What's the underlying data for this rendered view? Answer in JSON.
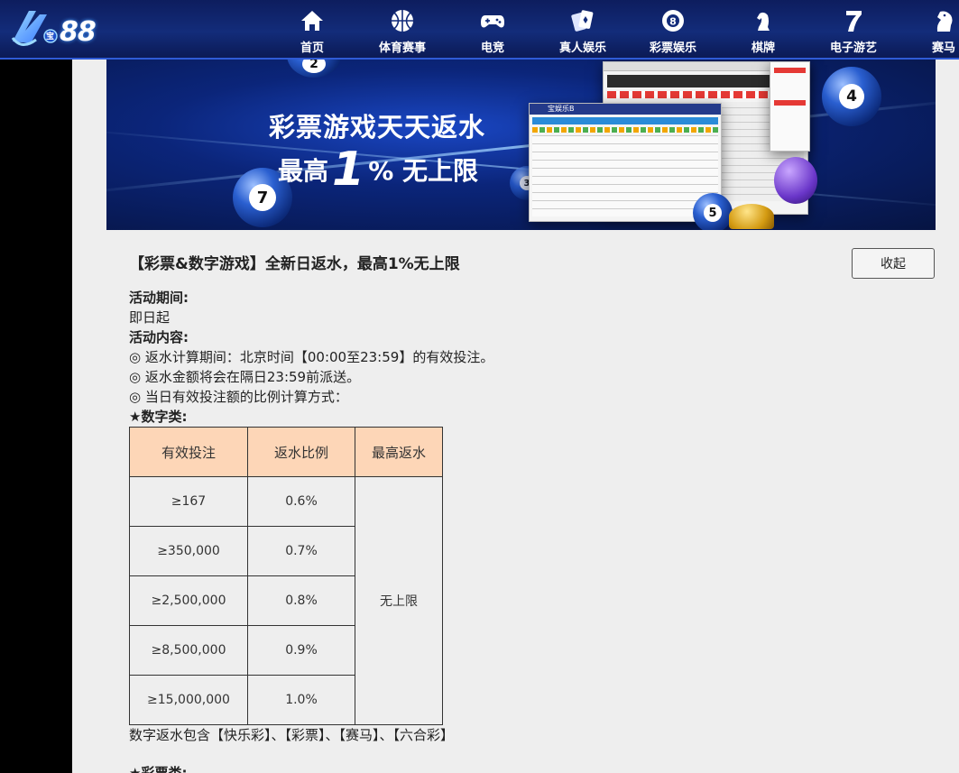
{
  "header": {
    "logo_text": "88",
    "logo_small": "宝",
    "nav": [
      {
        "label": "首页",
        "icon": "home-icon"
      },
      {
        "label": "体育赛事",
        "icon": "basketball-icon"
      },
      {
        "label": "电竞",
        "icon": "gamepad-icon"
      },
      {
        "label": "真人娱乐",
        "icon": "cards-icon"
      },
      {
        "label": "彩票娱乐",
        "icon": "lottery-ball-icon"
      },
      {
        "label": "棋牌",
        "icon": "chess-knight-icon"
      },
      {
        "label": "电子游艺",
        "icon": "slot-seven-icon"
      },
      {
        "label": "赛马",
        "icon": "horse-icon"
      }
    ]
  },
  "banner": {
    "line1": "彩票游戏天天返水",
    "line2_prefix": "最高",
    "line2_big": "1",
    "line2_suffix": "% 无上限",
    "screenshot_brand": "宝娱乐B",
    "ball_numbers": [
      "7",
      "4",
      "5",
      "2",
      "3"
    ]
  },
  "promo": {
    "title": "【彩票&数字游戏】全新日返水，最高1%无上限",
    "collapse_label": "收起",
    "period_label": "活动期间:",
    "period_value": "即日起",
    "content_label": "活动内容:",
    "items": [
      "◎ 返水计算期间：北京时间【00:00至23:59】的有效投注。",
      "◎ 返水金额将会在隔日23:59前派送。",
      "◎ 当日有效投注额的比例计算方式："
    ],
    "digital_label": "★数字类:",
    "table": {
      "headers": [
        "有效投注",
        "返水比例",
        "最高返水"
      ],
      "rows": [
        {
          "bet": "≥167",
          "rate": "0.6%"
        },
        {
          "bet": "≥350,000",
          "rate": "0.7%"
        },
        {
          "bet": "≥2,500,000",
          "rate": "0.8%"
        },
        {
          "bet": "≥8,500,000",
          "rate": "0.9%"
        },
        {
          "bet": "≥15,000,000",
          "rate": "1.0%"
        }
      ],
      "max_value": "无上限"
    },
    "footnote": "数字返水包含【快乐彩】、【彩票】、【赛马】、【六合彩】",
    "next_label": "★彩票类:"
  },
  "colors": {
    "header_bg": "#132c7a",
    "table_header": "#fdd6b7",
    "content_bg": "#eeeeee"
  }
}
